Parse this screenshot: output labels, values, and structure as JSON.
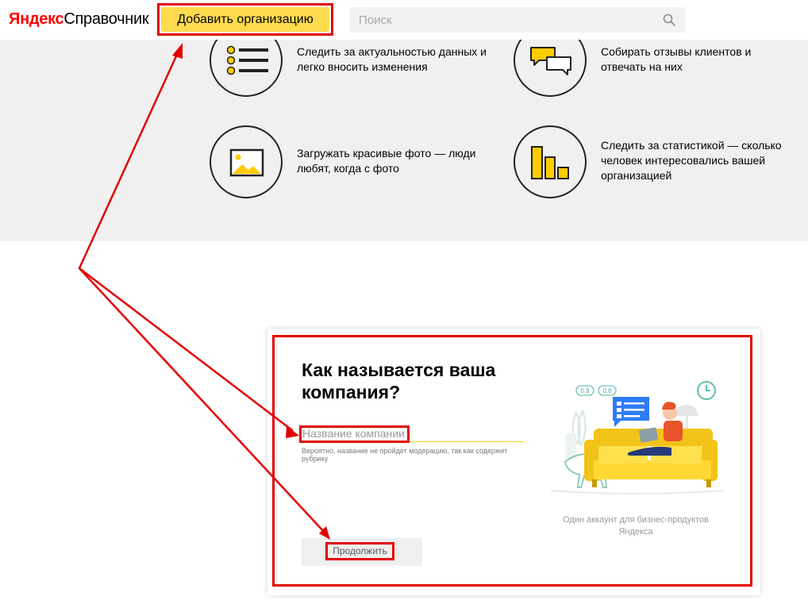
{
  "header": {
    "logo_brand": "Яндекс",
    "logo_product": "Справочник",
    "add_org_button": "Добавить организацию",
    "search_placeholder": "Поиск"
  },
  "features": [
    {
      "icon": "list-icon",
      "text": "Следить за актуальностью данных и легко вносить изменения"
    },
    {
      "icon": "chat-bubbles-icon",
      "text": "Собирать отзывы клиентов и отвечать на них"
    },
    {
      "icon": "photo-icon",
      "text": "Загружать красивые фото — люди любят, когда с фото"
    },
    {
      "icon": "bar-chart-icon",
      "text": "Следить за статистикой — сколько человек интересовались вашей организацией"
    }
  ],
  "card": {
    "title": "Как называется ваша компания?",
    "input_placeholder": "Название компании",
    "hint": "Вероятно, название не пройдет модерацию, так как содержит рубрику",
    "continue_button": "Продолжить",
    "caption": "Один аккаунт для бизнес-продуктов Яндекса",
    "illustration_badges": [
      "0.9",
      "0.8"
    ]
  },
  "colors": {
    "accent_yellow": "#ffdb4d",
    "annotation_red": "#e30000",
    "band_gray": "#f0f0f0",
    "logo_red": "#ff0000"
  }
}
